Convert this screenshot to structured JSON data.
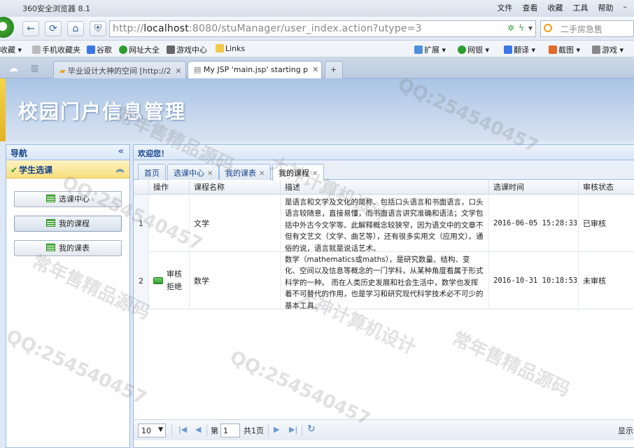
{
  "browser": {
    "title": "360安全浏览器 8.1",
    "menu": [
      "文件",
      "查看",
      "收藏",
      "工具",
      "帮助"
    ],
    "url_host": "localhost",
    "url_rest": ":8080/stuManager/user_index.action?utype=3",
    "url_prefix": "http://",
    "search_placeholder": "二手房急售",
    "bookmarks": [
      "收藏",
      "手机收藏夹",
      "谷歌",
      "网址大全",
      "游戏中心",
      "Links"
    ],
    "bookmarks_right": [
      "扩展",
      "网银",
      "翻译",
      "截图",
      "游戏"
    ],
    "tabs": [
      {
        "label": "毕业设计大神的空间 [http://2"
      },
      {
        "label": "My JSP 'main.jsp' starting p"
      }
    ]
  },
  "banner": {
    "title": "校园门户信息管理"
  },
  "sidebar": {
    "header": "导航",
    "section": "学生选课",
    "buttons": [
      {
        "label": "选课中心"
      },
      {
        "label": "我的课程"
      },
      {
        "label": "我的课表"
      }
    ]
  },
  "main": {
    "welcome": "欢迎您！",
    "tabs": [
      {
        "label": "首页"
      },
      {
        "label": "选课中心"
      },
      {
        "label": "我的课表"
      },
      {
        "label": "我的课程"
      }
    ],
    "columns": [
      "操作",
      "课程名称",
      "描述",
      "选课时间",
      "审核状态"
    ],
    "rows": [
      {
        "num": "1",
        "ops": [],
        "name": "文学",
        "desc": "是语言和文学及文化的简称。包括口头语言和书面语言，口头语言较随意，直接易懂，而书面语言讲究准确和语法；文学包括中外古今文学等。此解释概念较狭窄，因为语文中的文章不但有文艺文（文学、曲艺等），还有很多实用文（应用文）。通俗的说，语言就是说话艺术。",
        "time": "2016-06-05 15:28:33",
        "status": "已审核"
      },
      {
        "num": "2",
        "ops": [
          "审核",
          "拒绝"
        ],
        "name": "数学",
        "desc": "数学（mathematics或maths），是研究数量、结构、变化、空间以及信息等概念的一门学科，从某种角度看属于形式科学的一种。 而在人类历史发展和社会生活中，数学也发挥着不可替代的作用，也是学习和研究现代科学技术必不可少的基本工具。",
        "time": "2016-10-31 10:18:53",
        "status": "未审核"
      }
    ],
    "pager": {
      "page_size": "10",
      "page_label_pre": "第",
      "page_value": "1",
      "page_label_post": "共1页",
      "info": "显示"
    }
  },
  "watermark": {
    "qq": "QQ:254540457",
    "slogan": "常年售精品源码",
    "slogan2": "大神计算机设计"
  },
  "colors": {
    "accent": "#15428b",
    "border": "#99bbe8"
  }
}
